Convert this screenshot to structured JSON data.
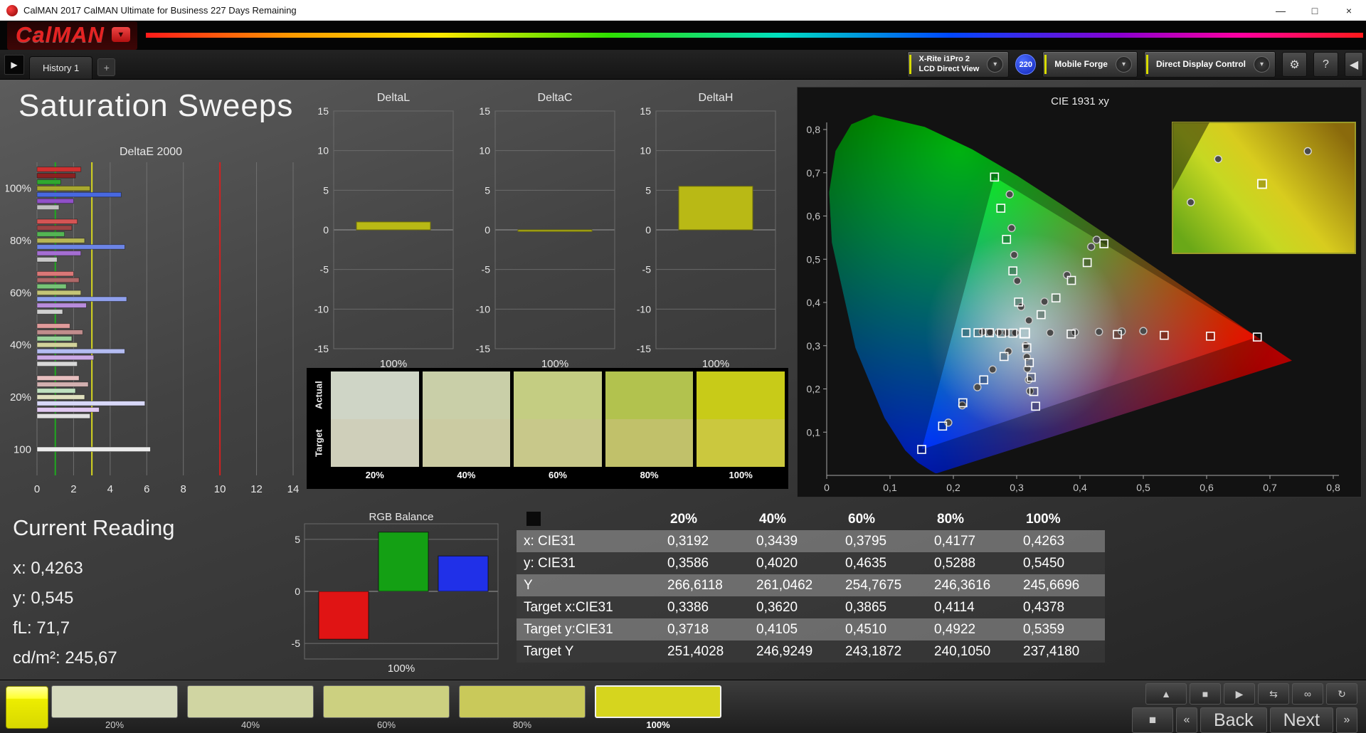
{
  "window": {
    "title": "CalMAN 2017 CalMAN Ultimate for Business 227 Days Remaining",
    "brand": "CalMAN"
  },
  "icons": {
    "minimize": "—",
    "maximize": "□",
    "close": "×",
    "prev_tab": "▶",
    "collapse": "◀",
    "add_tab": "+",
    "dropdown": "▾",
    "gear": "⚙",
    "help": "?",
    "logo_arrow": "▼",
    "expand": "▲",
    "stop": "■",
    "play": "▶",
    "step": "⇆",
    "infinity": "∞",
    "loop": "↻",
    "big_stop": "■",
    "chev_left": "«",
    "chev_right": "»"
  },
  "tabs": {
    "history": "History 1"
  },
  "toolbar": {
    "meter_line1": "X-Rite i1Pro 2",
    "meter_line2": "LCD Direct View",
    "badge": "220",
    "source": "Mobile Forge",
    "control": "Direct Display Control"
  },
  "colors": {
    "accent_yellow": "#d8dc00",
    "badge_blue": "#1f3bd4"
  },
  "page_title": "Saturation Sweeps",
  "current_reading": {
    "title": "Current Reading",
    "lines": [
      "x: 0,4263",
      "y: 0,545",
      "fL: 71,7",
      "cd/m²: 245,67"
    ]
  },
  "saturation_swatches": {
    "row_labels": [
      "Actual",
      "Target"
    ],
    "columns": [
      {
        "label": "20%",
        "actual": "#cfd5c6",
        "target": "#cfcfba"
      },
      {
        "label": "40%",
        "actual": "#c9cfa8",
        "target": "#cbcba2"
      },
      {
        "label": "60%",
        "actual": "#c4cd82",
        "target": "#c8c88a"
      },
      {
        "label": "80%",
        "actual": "#b2c24e",
        "target": "#c1c16a"
      },
      {
        "label": "100%",
        "actual": "#c8cb18",
        "target": "#cbc83e"
      }
    ]
  },
  "table": {
    "columns": [
      "",
      "20%",
      "40%",
      "60%",
      "80%",
      "100%"
    ],
    "rows": [
      {
        "label": "x: CIE31",
        "values": [
          "0,3192",
          "0,3439",
          "0,3795",
          "0,4177",
          "0,4263"
        ]
      },
      {
        "label": "y: CIE31",
        "values": [
          "0,3586",
          "0,4020",
          "0,4635",
          "0,5288",
          "0,5450"
        ]
      },
      {
        "label": "Y",
        "values": [
          "266,6118",
          "261,0462",
          "254,7675",
          "246,3616",
          "245,6696"
        ]
      },
      {
        "label": "Target x:CIE31",
        "values": [
          "0,3386",
          "0,3620",
          "0,3865",
          "0,4114",
          "0,4378"
        ]
      },
      {
        "label": "Target y:CIE31",
        "values": [
          "0,3718",
          "0,4105",
          "0,4510",
          "0,4922",
          "0,5359"
        ]
      },
      {
        "label": "Target Y",
        "values": [
          "251,4028",
          "246,9249",
          "243,1872",
          "240,1050",
          "237,4180"
        ]
      }
    ]
  },
  "bottom": {
    "swatches": [
      {
        "label": "20%",
        "color": "#d6dabe",
        "active": false
      },
      {
        "label": "40%",
        "color": "#d0d5a2",
        "active": false
      },
      {
        "label": "60%",
        "color": "#ccd080",
        "active": false
      },
      {
        "label": "80%",
        "color": "#c9c95a",
        "active": false
      },
      {
        "label": "100%",
        "color": "#d6d51e",
        "active": true
      }
    ],
    "back": "Back",
    "next": "Next"
  },
  "chart_data": [
    {
      "id": "deltae2000",
      "type": "bar",
      "orientation": "horizontal",
      "title": "DeltaE 2000",
      "xlim": [
        0,
        14
      ],
      "xticks": [
        0,
        2,
        4,
        6,
        8,
        10,
        12,
        14
      ],
      "reference_lines": [
        {
          "x": 1,
          "color": "#1faa1f"
        },
        {
          "x": 3,
          "color": "#d6d61f"
        },
        {
          "x": 10,
          "color": "#d61f1f"
        }
      ],
      "groups": [
        {
          "label": "100%",
          "bars": [
            {
              "color": "#d03030",
              "value": 2.4
            },
            {
              "color": "#8a2020",
              "value": 2.1
            },
            {
              "color": "#30a830",
              "value": 1.3
            },
            {
              "color": "#a8a830",
              "value": 2.9
            },
            {
              "color": "#4868e0",
              "value": 4.6
            },
            {
              "color": "#9050c8",
              "value": 2.0
            },
            {
              "color": "#c0c0c0",
              "value": 1.2
            }
          ]
        },
        {
          "label": "80%",
          "bars": [
            {
              "color": "#d55454",
              "value": 2.2
            },
            {
              "color": "#9c4444",
              "value": 1.9
            },
            {
              "color": "#54b654",
              "value": 1.5
            },
            {
              "color": "#b6b654",
              "value": 2.6
            },
            {
              "color": "#6c84e6",
              "value": 4.8
            },
            {
              "color": "#a46ed2",
              "value": 2.4
            },
            {
              "color": "#c8c8c8",
              "value": 1.1
            }
          ]
        },
        {
          "label": "60%",
          "bars": [
            {
              "color": "#db7777",
              "value": 2.0
            },
            {
              "color": "#ae6868",
              "value": 2.3
            },
            {
              "color": "#77c477",
              "value": 1.6
            },
            {
              "color": "#c4c477",
              "value": 2.4
            },
            {
              "color": "#90a0ec",
              "value": 4.9
            },
            {
              "color": "#b88cdc",
              "value": 2.7
            },
            {
              "color": "#d0d0d0",
              "value": 1.4
            }
          ]
        },
        {
          "label": "40%",
          "bars": [
            {
              "color": "#e19b9b",
              "value": 1.8
            },
            {
              "color": "#c08c8c",
              "value": 2.5
            },
            {
              "color": "#9bd29b",
              "value": 1.9
            },
            {
              "color": "#d2d29b",
              "value": 2.2
            },
            {
              "color": "#b4bcf2",
              "value": 4.8
            },
            {
              "color": "#ccaae6",
              "value": 3.1
            },
            {
              "color": "#d8d8d8",
              "value": 2.2
            }
          ]
        },
        {
          "label": "20%",
          "bars": [
            {
              "color": "#e7bfbf",
              "value": 2.3
            },
            {
              "color": "#d2b0b0",
              "value": 2.8
            },
            {
              "color": "#bfe0bf",
              "value": 2.1
            },
            {
              "color": "#e0e0bf",
              "value": 2.6
            },
            {
              "color": "#d8d8f8",
              "value": 5.9
            },
            {
              "color": "#e0c8f0",
              "value": 3.4
            },
            {
              "color": "#e0e0e0",
              "value": 2.9
            }
          ]
        },
        {
          "label": "100",
          "bars": [
            {
              "color": "#ececec",
              "value": 6.2
            }
          ]
        }
      ]
    },
    {
      "id": "deltaL",
      "type": "bar",
      "title": "DeltaL",
      "ylim": [
        -15,
        15
      ],
      "yticks": [
        15,
        10,
        5,
        0,
        -5,
        -10,
        -15
      ],
      "categories": [
        "100%"
      ],
      "values": [
        1.0
      ],
      "bar_color": "#b9b915"
    },
    {
      "id": "deltaC",
      "type": "bar",
      "title": "DeltaC",
      "ylim": [
        -15,
        15
      ],
      "yticks": [
        15,
        10,
        5,
        0,
        -5,
        -10,
        -15
      ],
      "categories": [
        "100%"
      ],
      "values": [
        -0.2
      ],
      "bar_color": "#b9b915"
    },
    {
      "id": "deltaH",
      "type": "bar",
      "title": "DeltaH",
      "ylim": [
        -15,
        15
      ],
      "yticks": [
        15,
        10,
        5,
        0,
        -5,
        -10,
        -15
      ],
      "categories": [
        "100%"
      ],
      "values": [
        5.5
      ],
      "bar_color": "#b9b915"
    },
    {
      "id": "rgb_balance",
      "type": "bar",
      "title": "RGB Balance",
      "ylim": [
        -6.5,
        6.5
      ],
      "yticks": [
        5,
        0,
        -5
      ],
      "categories": [
        "100%"
      ],
      "series": [
        {
          "name": "red",
          "color": "#e01414",
          "value": -4.6
        },
        {
          "name": "green",
          "color": "#14a014",
          "value": 5.7
        },
        {
          "name": "blue",
          "color": "#2030e8",
          "value": 3.4
        }
      ]
    },
    {
      "id": "cie1931",
      "type": "scatter",
      "title": "CIE 1931 xy",
      "xlim": [
        0,
        0.8
      ],
      "ylim": [
        0,
        0.8
      ],
      "xtick_labels": [
        "0",
        "0,1",
        "0,2",
        "0,3",
        "0,4",
        "0,5",
        "0,6",
        "0,7",
        "0,8"
      ],
      "ytick_labels": [
        "0,1",
        "0,2",
        "0,3",
        "0,4",
        "0,5",
        "0,6",
        "0,7",
        "0,8"
      ],
      "white_point": [
        0.3127,
        0.329
      ],
      "target_sweeps": {
        "red": [
          [
            0.386,
            0.327
          ],
          [
            0.459,
            0.326
          ],
          [
            0.533,
            0.324
          ],
          [
            0.606,
            0.322
          ],
          [
            0.68,
            0.32
          ]
        ],
        "green": [
          [
            0.303,
            0.401
          ],
          [
            0.294,
            0.473
          ],
          [
            0.284,
            0.546
          ],
          [
            0.275,
            0.618
          ],
          [
            0.265,
            0.69
          ]
        ],
        "blue": [
          [
            0.28,
            0.275
          ],
          [
            0.248,
            0.221
          ],
          [
            0.215,
            0.168
          ],
          [
            0.183,
            0.114
          ],
          [
            0.15,
            0.06
          ]
        ],
        "yellow": [
          [
            0.3386,
            0.3718
          ],
          [
            0.362,
            0.4105
          ],
          [
            0.3865,
            0.451
          ],
          [
            0.4114,
            0.4922
          ],
          [
            0.4378,
            0.5359
          ]
        ],
        "cyan": [
          [
            0.294,
            0.329
          ],
          [
            0.276,
            0.329
          ],
          [
            0.257,
            0.33
          ],
          [
            0.239,
            0.33
          ],
          [
            0.22,
            0.33
          ]
        ],
        "magenta": [
          [
            0.316,
            0.295
          ],
          [
            0.32,
            0.261
          ],
          [
            0.323,
            0.227
          ],
          [
            0.327,
            0.194
          ],
          [
            0.33,
            0.16
          ]
        ]
      },
      "measured_sweeps": {
        "yellow": [
          [
            0.3192,
            0.3586
          ],
          [
            0.3439,
            0.402
          ],
          [
            0.3795,
            0.4635
          ],
          [
            0.4177,
            0.5288
          ],
          [
            0.4263,
            0.545
          ]
        ],
        "red": [
          [
            0.353,
            0.33
          ],
          [
            0.392,
            0.331
          ],
          [
            0.43,
            0.332
          ],
          [
            0.466,
            0.333
          ],
          [
            0.5,
            0.334
          ]
        ],
        "green": [
          [
            0.307,
            0.39
          ],
          [
            0.301,
            0.45
          ],
          [
            0.296,
            0.51
          ],
          [
            0.292,
            0.572
          ],
          [
            0.289,
            0.65
          ]
        ],
        "blue": [
          [
            0.287,
            0.287
          ],
          [
            0.262,
            0.245
          ],
          [
            0.238,
            0.204
          ],
          [
            0.214,
            0.162
          ],
          [
            0.192,
            0.122
          ]
        ],
        "cyan": [
          [
            0.298,
            0.33
          ],
          [
            0.284,
            0.33
          ],
          [
            0.271,
            0.331
          ],
          [
            0.258,
            0.331
          ],
          [
            0.246,
            0.332
          ]
        ],
        "magenta": [
          [
            0.314,
            0.301
          ],
          [
            0.316,
            0.274
          ],
          [
            0.317,
            0.247
          ],
          [
            0.319,
            0.221
          ],
          [
            0.321,
            0.195
          ]
        ]
      },
      "inset": {
        "square": [
          [
            0.49,
            0.47
          ]
        ],
        "circles": [
          [
            0.25,
            0.28
          ],
          [
            0.1,
            0.61
          ],
          [
            0.74,
            0.22
          ]
        ]
      }
    }
  ]
}
